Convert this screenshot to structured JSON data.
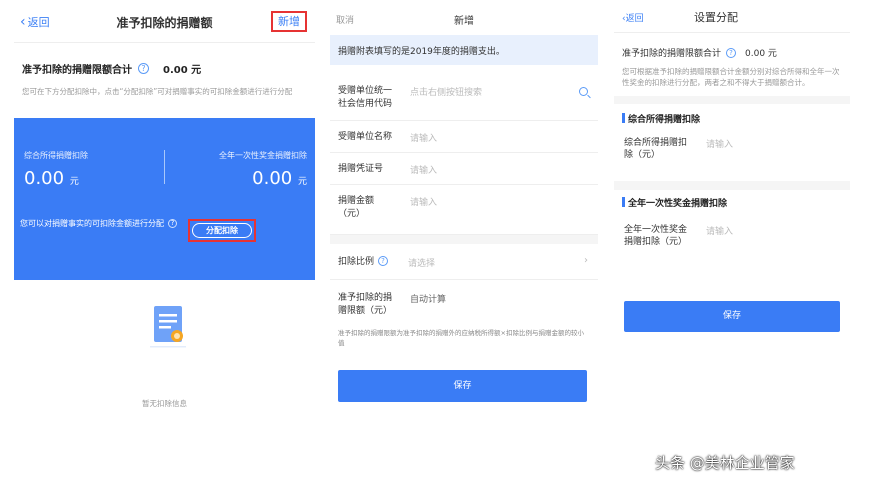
{
  "panel1": {
    "back_label": "返回",
    "title": "准予扣除的捐赠额",
    "add_label": "新增",
    "limit_label": "准予扣除的捐赠限额合计",
    "limit_value": "0.00 元",
    "desc": "您可在下方分配扣除中，点击“分配扣除”可对捐赠事实的可扣除金额进行进行分配",
    "card": {
      "left_label": "综合所得捐赠扣除",
      "left_amount": "0.00",
      "left_unit": "元",
      "right_label": "全年一次性奖金捐赠扣除",
      "right_amount": "0.00",
      "right_unit": "元",
      "bottom_text": "您可以对捐赠事实的可扣除金额进行分配",
      "allocate_label": "分配扣除"
    },
    "empty_text": "暂无扣除信息"
  },
  "panel2": {
    "cancel_label": "取消",
    "title": "新增",
    "notice": "捐赠附表填写的是2019年度的捐赠支出。",
    "fields": {
      "credit_code_label": "受赠单位统一社会信用代码",
      "credit_code_placeholder": "点击右侧按钮搜索",
      "unit_name_label": "受赠单位名称",
      "unit_name_placeholder": "请输入",
      "voucher_label": "捐赠凭证号",
      "voucher_placeholder": "请输入",
      "amount_label": "捐赠金额（元）",
      "amount_placeholder": "请输入",
      "ratio_label": "扣除比例",
      "ratio_placeholder": "请选择",
      "limit_label": "准予扣除的捐赠限额（元）",
      "limit_value": "自动计算"
    },
    "formula": "准予扣除的捐赠限额为准予扣除的捐赠外的应纳税所得额×扣除比例与捐赠金额的较小值",
    "save_label": "保存"
  },
  "panel3": {
    "back_label": "返回",
    "title": "设置分配",
    "limit_label": "准予扣除的捐赠限额合计",
    "limit_value": "0.00 元",
    "desc": "您可根据准予扣除的捐赠限额合计金额分别对综合所得和全年一次性奖金的扣除进行分配，两者之和不得大于捐赠额合计。",
    "section1": "综合所得捐赠扣除",
    "field1_label": "综合所得捐赠扣除（元）",
    "field1_placeholder": "请输入",
    "section2": "全年一次性奖金捐赠扣除",
    "field2_label": "全年一次性奖金捐赠扣除（元）",
    "field2_placeholder": "请输入",
    "save_label": "保存"
  },
  "watermark": "头条 @美林企业管家",
  "colors": {
    "brand_blue": "#3a7cf5",
    "highlight_red": "#e63333",
    "notice_bg": "#e8f0fd"
  }
}
